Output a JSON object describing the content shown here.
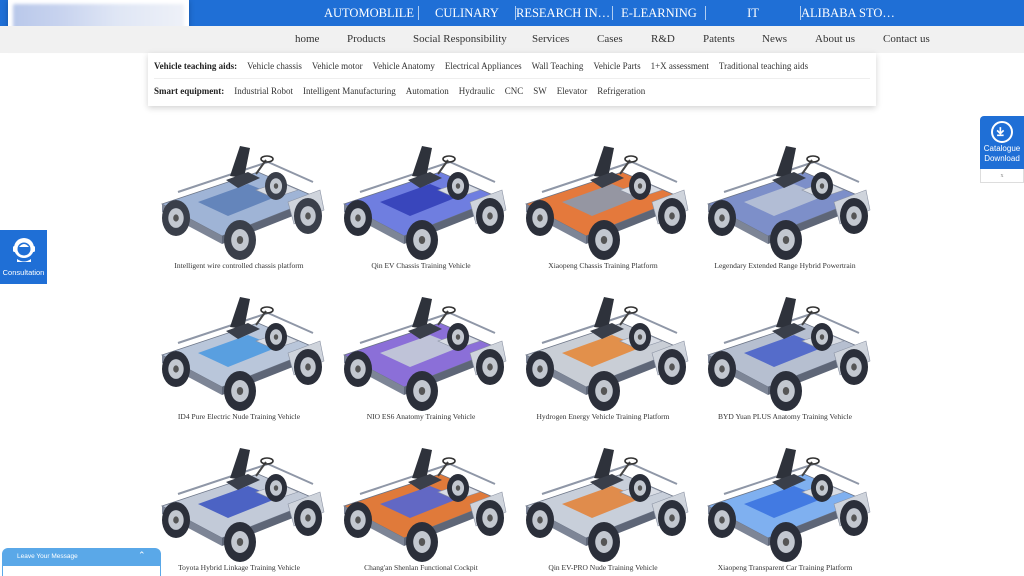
{
  "top_nav": [
    "AUTOMOBLILE",
    "CULINARY",
    "RESEARCH INS...",
    "E-LEARNING",
    "IT",
    "ALIBABA STORE"
  ],
  "main_nav": [
    "home",
    "Products",
    "Social Responsibility",
    "Services",
    "Cases",
    "R&D",
    "Patents",
    "News",
    "About us",
    "Contact us"
  ],
  "dropdown": {
    "teaching_label": "Vehicle teaching aids:",
    "teaching_items": [
      "Vehicle chassis",
      "Vehicle motor",
      "Vehicle Anatomy",
      "Electrical Appliances",
      "Wall Teaching",
      "Vehicle Parts",
      "1+X assessment",
      "Traditional teaching aids"
    ],
    "equipment_label": "Smart equipment:",
    "equipment_items": [
      "Industrial Robot",
      "Intelligent Manufacturing",
      "Automation",
      "Hydraulic",
      "CNC",
      "SW",
      "Elevator",
      "Refrigeration"
    ]
  },
  "products": [
    "Intelligent wire controlled chassis platform",
    "Qin EV Chassis Training Vehicle",
    "Xiaopeng Chassis Training Platform",
    "Legendary Extended Range Hybrid Powertrain",
    "ID4 Pure Electric Nude Training Vehicle",
    "NIO ES6 Anatomy Training Vehicle",
    "Hydrogen Energy Vehicle Training Platform",
    "BYD Yuan PLUS Anatomy Training Vehicle",
    "Toyota Hybrid Linkage Training Vehicle",
    "Chang'an Shenlan Functional Cockpit",
    "Qin EV-PRO Nude Training Vehicle",
    "Xiaopeng Transparent Car Training Platform"
  ],
  "catalogue": {
    "line1": "Catalogue",
    "line2": "Download",
    "close": "x"
  },
  "consultation": "Consultation",
  "leave_message": "Leave Your Message",
  "colors": {
    "brand_blue": "#1f6fd6",
    "leave_blue": "#5aa8e8",
    "nav_bg": "#f1f1f1"
  }
}
